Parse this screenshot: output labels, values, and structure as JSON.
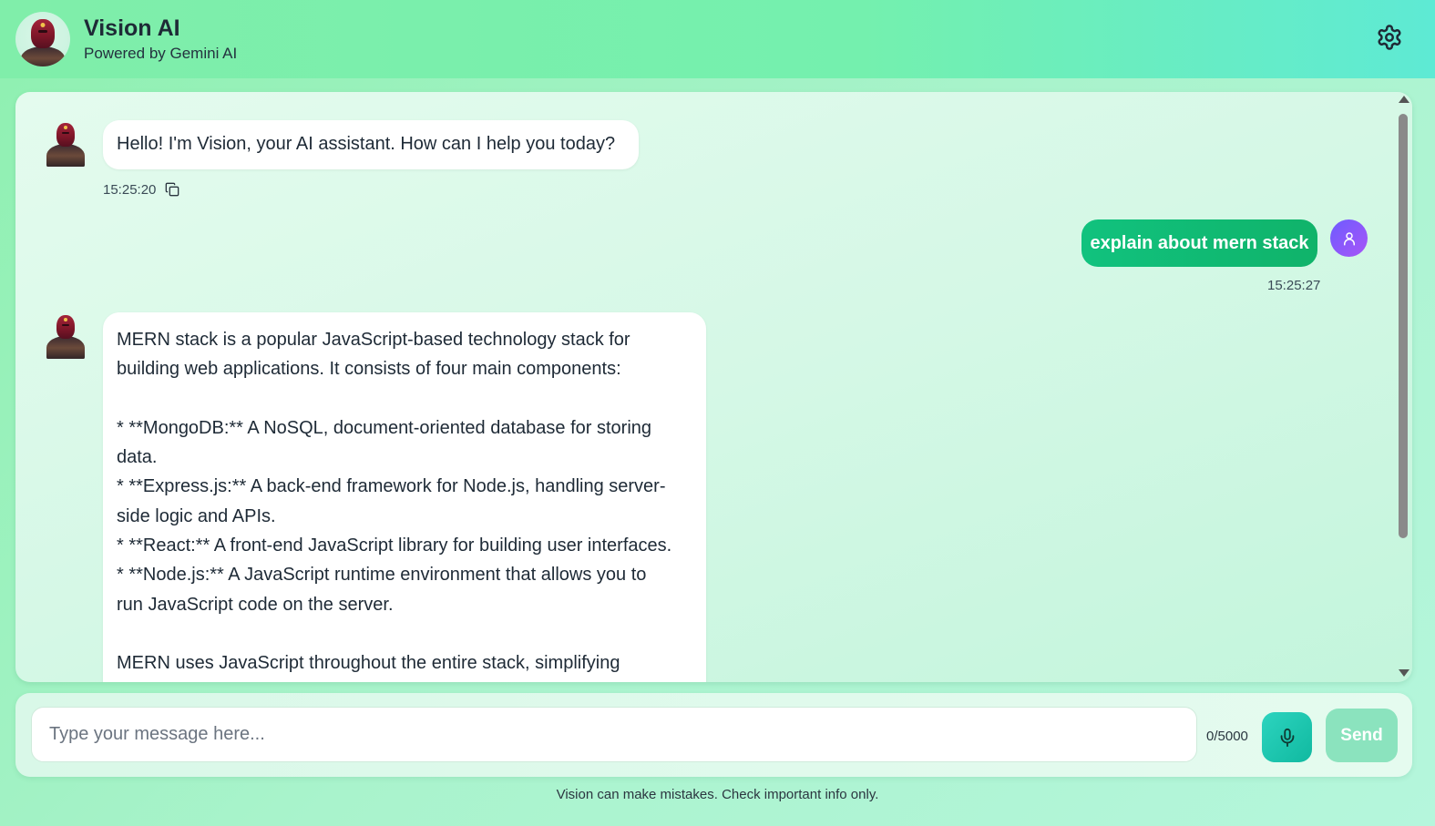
{
  "header": {
    "title": "Vision AI",
    "subtitle": "Powered by Gemini AI",
    "logo_icon": "vision-avatar-icon",
    "settings_icon": "gear-icon"
  },
  "messages": [
    {
      "role": "assistant",
      "text": "Hello! I'm Vision, your AI assistant. How can I help you today?",
      "time": "15:25:20"
    },
    {
      "role": "user",
      "text": "explain about mern stack",
      "time": "15:25:27"
    },
    {
      "role": "assistant",
      "lines": [
        "MERN stack is a popular JavaScript-based technology stack for",
        "building web applications.  It consists of four main components:",
        "",
        "* **MongoDB:** A NoSQL, document-oriented database for storing",
        "data.",
        "* **Express.js:** A back-end framework for Node.js, handling server-",
        "side logic and APIs.",
        "* **React:** A front-end JavaScript library for building user interfaces.",
        "* **Node.js:** A JavaScript runtime environment that allows you to",
        "run JavaScript code on the server.",
        "",
        "MERN uses JavaScript throughout the entire stack, simplifying"
      ]
    }
  ],
  "composer": {
    "placeholder": "Type your message here...",
    "value": "",
    "char_count": "0/5000",
    "mic_icon": "microphone-icon",
    "send_label": "Send"
  },
  "footer": {
    "disclaimer": "Vision can make mistakes. Check important info only."
  },
  "colors": {
    "header_bg": "#74f0ae",
    "user_bubble": "#10b36a",
    "user_avatar": "#8b5cf6",
    "mic_button": "#2dd4bf",
    "send_button": "#8be3be"
  }
}
